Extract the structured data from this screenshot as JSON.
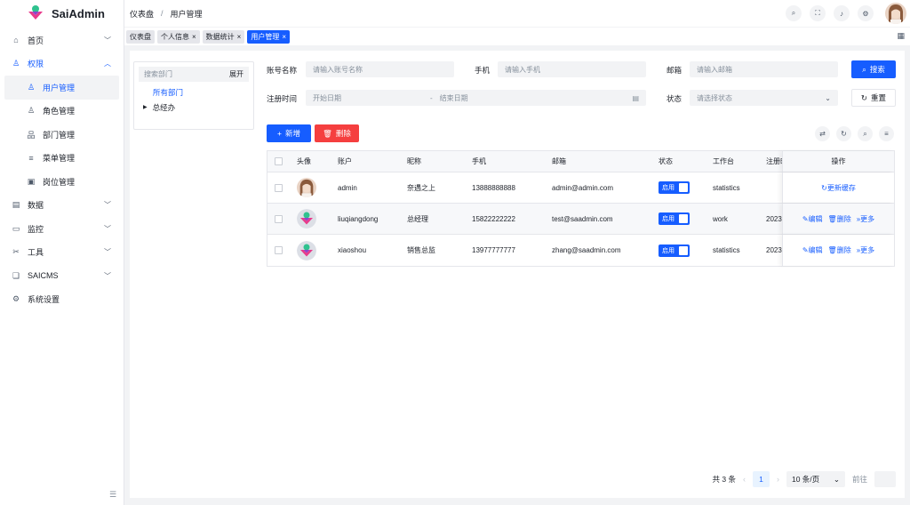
{
  "app": {
    "name": "SaiAdmin"
  },
  "breadcrumb": [
    "仪表盘",
    "用户管理"
  ],
  "header_icons": [
    "search-icon",
    "fullscreen-icon",
    "bell-icon",
    "settings-icon"
  ],
  "tabs": [
    {
      "label": "仪表盘",
      "closable": false,
      "active": false
    },
    {
      "label": "个人信息",
      "closable": true,
      "active": false
    },
    {
      "label": "数据统计",
      "closable": true,
      "active": false
    },
    {
      "label": "用户管理",
      "closable": true,
      "active": true
    }
  ],
  "sidebar": {
    "items": [
      {
        "label": "首页",
        "icon": "home-icon",
        "chevron": "down"
      },
      {
        "label": "权限",
        "icon": "user-shield-icon",
        "chevron": "up",
        "open": true
      },
      {
        "label": "用户管理",
        "icon": "user-icon",
        "sub": true,
        "active": true
      },
      {
        "label": "角色管理",
        "icon": "role-icon",
        "sub": true
      },
      {
        "label": "部门管理",
        "icon": "org-icon",
        "sub": true
      },
      {
        "label": "菜单管理",
        "icon": "menu-icon",
        "sub": true
      },
      {
        "label": "岗位管理",
        "icon": "post-icon",
        "sub": true
      },
      {
        "label": "数据",
        "icon": "data-icon",
        "chevron": "down"
      },
      {
        "label": "监控",
        "icon": "monitor-icon",
        "chevron": "down"
      },
      {
        "label": "工具",
        "icon": "tool-icon",
        "chevron": "down"
      },
      {
        "label": "SAICMS",
        "icon": "cms-icon",
        "chevron": "down"
      },
      {
        "label": "系统设置",
        "icon": "gear-icon"
      }
    ]
  },
  "dept": {
    "search_placeholder": "搜索部门",
    "expand_label": "展开",
    "all_label": "所有部门",
    "root_node": "总经办"
  },
  "filters": {
    "account_label": "账号名称",
    "account_placeholder": "请输入账号名称",
    "phone_label": "手机",
    "phone_placeholder": "请输入手机",
    "email_label": "邮箱",
    "email_placeholder": "请输入邮箱",
    "regtime_label": "注册时间",
    "start_placeholder": "开始日期",
    "range_sep": "-",
    "end_placeholder": "结束日期",
    "status_label": "状态",
    "status_placeholder": "请选择状态",
    "search_button": "搜索",
    "reset_button": "重置"
  },
  "actions": {
    "add_button": "新增",
    "delete_button": "删除"
  },
  "table": {
    "headers": [
      "头像",
      "账户",
      "昵称",
      "手机",
      "邮箱",
      "状态",
      "工作台",
      "注册时",
      "操作"
    ],
    "rows": [
      {
        "account": "admin",
        "nickname": "奈遇之上",
        "phone": "13888888888",
        "email": "admin@admin.com",
        "status": "启用",
        "workspace": "statistics",
        "regtime": "",
        "ops": [
          "更新缓存"
        ],
        "avatar": "photo"
      },
      {
        "account": "liuqiangdong",
        "nickname": "总经理",
        "phone": "15822222222",
        "email": "test@saadmin.com",
        "status": "启用",
        "workspace": "work",
        "regtime": "2023",
        "ops": [
          "编辑",
          "删除",
          "更多"
        ],
        "avatar": "logo"
      },
      {
        "account": "xiaoshou",
        "nickname": "销售总监",
        "phone": "13977777777",
        "email": "zhang@saadmin.com",
        "status": "启用",
        "workspace": "statistics",
        "regtime": "2023",
        "ops": [
          "编辑",
          "删除",
          "更多"
        ],
        "avatar": "logo"
      }
    ]
  },
  "pagination": {
    "total_text": "共 3 条",
    "current_page": "1",
    "page_size": "10 条/页",
    "goto_label": "前往"
  }
}
